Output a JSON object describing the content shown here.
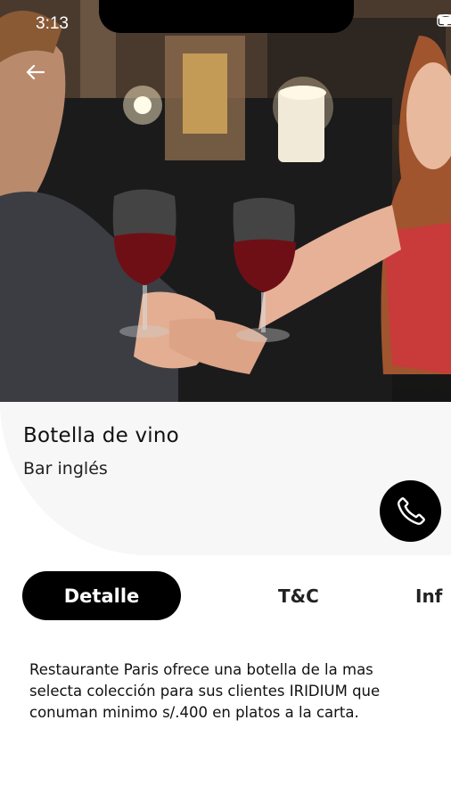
{
  "status_bar": {
    "time": "3:13"
  },
  "hero": {
    "image_description_icon": "dinner-photo"
  },
  "item": {
    "title": "Botella de vino",
    "subtitle": "Bar inglés"
  },
  "tabs": [
    {
      "label": "Detalle",
      "active": true
    },
    {
      "label": "T&C",
      "active": false
    },
    {
      "label": "Inf",
      "active": false
    }
  ],
  "description": "Restaurante Paris ofrece una botella de la mas selecta colección para sus clientes IRIDIUM que conuman minimo s/.400 en platos a la carta.",
  "colors": {
    "accent": "#000000",
    "card_bg": "#f7f7f7",
    "text": "#111111"
  }
}
